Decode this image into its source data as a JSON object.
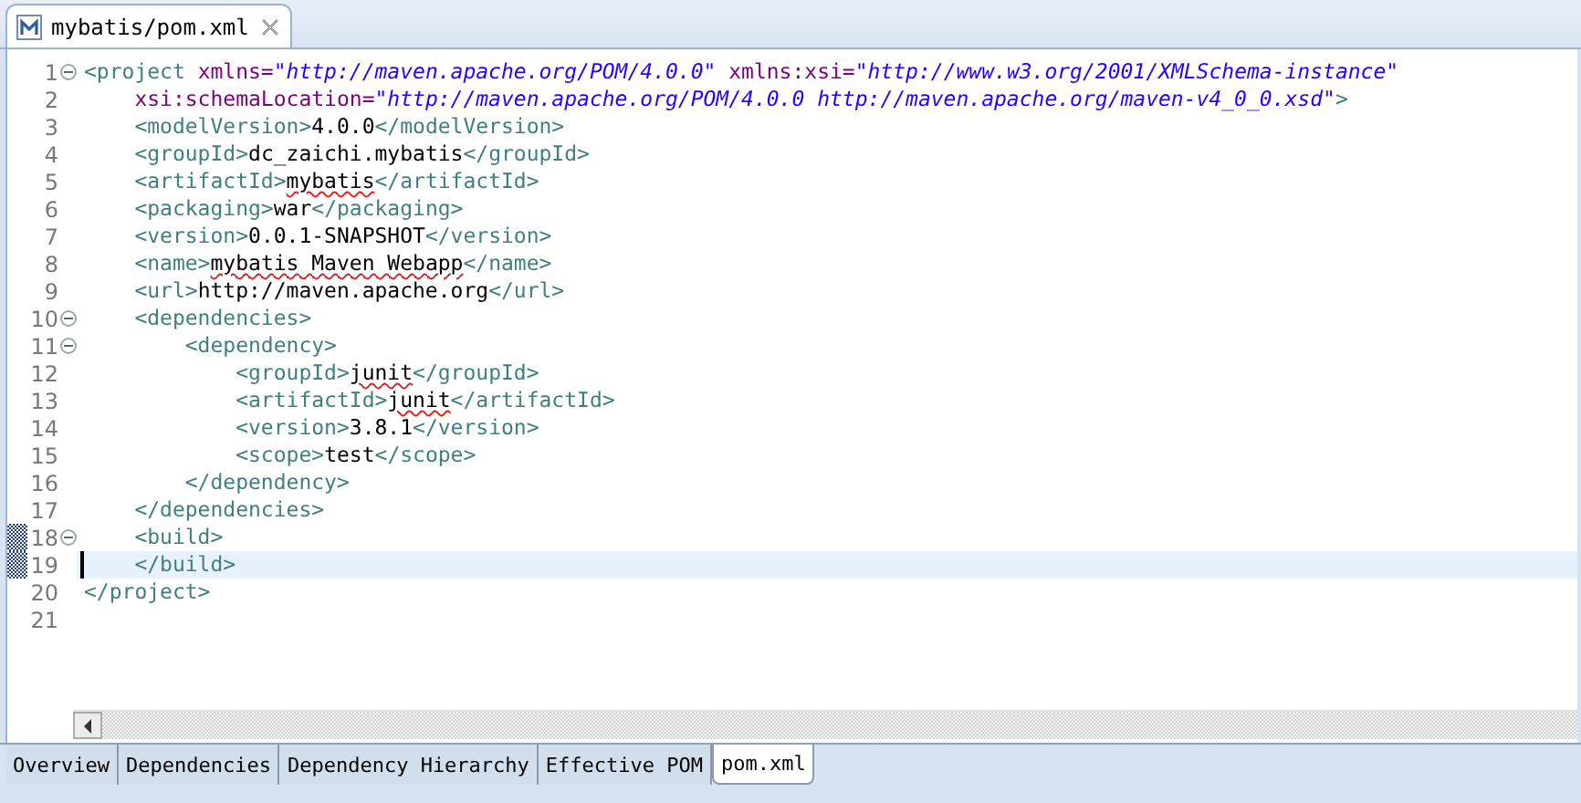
{
  "editor_tab": {
    "title": "mybatis/pom.xml",
    "selected": true
  },
  "lines": [
    {
      "number": "1",
      "fold": true,
      "changed": false,
      "current": false,
      "tokens": [
        {
          "kind": "tag",
          "text": "<project"
        },
        {
          "kind": "attr",
          "text": " xmlns="
        },
        {
          "kind": "value",
          "text": "\"http://maven.apache.org/POM/4.0.0\""
        },
        {
          "kind": "attr",
          "text": " xmlns:xsi="
        },
        {
          "kind": "value",
          "text": "\"http://www.w3.org/2001/XMLSchema-instance\""
        }
      ]
    },
    {
      "number": "2",
      "fold": false,
      "changed": false,
      "current": false,
      "tokens": [
        {
          "kind": "attr",
          "text": "    xsi:schemaLocation="
        },
        {
          "kind": "value",
          "text": "\"http://maven.apache.org/POM/4.0.0 http://maven.apache.org/maven-v4_0_0.xsd\""
        },
        {
          "kind": "tag",
          "text": ">"
        }
      ]
    },
    {
      "number": "3",
      "fold": false,
      "changed": false,
      "current": false,
      "tokens": [
        {
          "kind": "tag",
          "text": "    <modelVersion>"
        },
        {
          "kind": "text",
          "text": "4.0.0"
        },
        {
          "kind": "tag",
          "text": "</modelVersion>"
        }
      ]
    },
    {
      "number": "4",
      "fold": false,
      "changed": false,
      "current": false,
      "tokens": [
        {
          "kind": "tag",
          "text": "    <groupId>"
        },
        {
          "kind": "text",
          "text": "dc_zaichi.mybatis"
        },
        {
          "kind": "tag",
          "text": "</groupId>"
        }
      ]
    },
    {
      "number": "5",
      "fold": false,
      "changed": false,
      "current": false,
      "tokens": [
        {
          "kind": "tag",
          "text": "    <artifactId>"
        },
        {
          "kind": "misspelled",
          "text": "mybatis"
        },
        {
          "kind": "tag",
          "text": "</artifactId>"
        }
      ]
    },
    {
      "number": "6",
      "fold": false,
      "changed": false,
      "current": false,
      "tokens": [
        {
          "kind": "tag",
          "text": "    <packaging>"
        },
        {
          "kind": "text",
          "text": "war"
        },
        {
          "kind": "tag",
          "text": "</packaging>"
        }
      ]
    },
    {
      "number": "7",
      "fold": false,
      "changed": false,
      "current": false,
      "tokens": [
        {
          "kind": "tag",
          "text": "    <version>"
        },
        {
          "kind": "text",
          "text": "0.0.1-SNAPSHOT"
        },
        {
          "kind": "tag",
          "text": "</version>"
        }
      ]
    },
    {
      "number": "8",
      "fold": false,
      "changed": false,
      "current": false,
      "tokens": [
        {
          "kind": "tag",
          "text": "    <name>"
        },
        {
          "kind": "misspelled",
          "text": "mybatis Maven Webapp"
        },
        {
          "kind": "tag",
          "text": "</name>"
        }
      ]
    },
    {
      "number": "9",
      "fold": false,
      "changed": false,
      "current": false,
      "tokens": [
        {
          "kind": "tag",
          "text": "    <url>"
        },
        {
          "kind": "text",
          "text": "http://maven.apache.org"
        },
        {
          "kind": "tag",
          "text": "</url>"
        }
      ]
    },
    {
      "number": "10",
      "fold": true,
      "changed": false,
      "current": false,
      "tokens": [
        {
          "kind": "tag",
          "text": "    <dependencies>"
        }
      ]
    },
    {
      "number": "11",
      "fold": true,
      "changed": false,
      "current": false,
      "tokens": [
        {
          "kind": "tag",
          "text": "        <dependency>"
        }
      ]
    },
    {
      "number": "12",
      "fold": false,
      "changed": false,
      "current": false,
      "tokens": [
        {
          "kind": "tag",
          "text": "            <groupId>"
        },
        {
          "kind": "misspelled",
          "text": "junit"
        },
        {
          "kind": "tag",
          "text": "</groupId>"
        }
      ]
    },
    {
      "number": "13",
      "fold": false,
      "changed": false,
      "current": false,
      "tokens": [
        {
          "kind": "tag",
          "text": "            <artifactId>"
        },
        {
          "kind": "misspelled",
          "text": "junit"
        },
        {
          "kind": "tag",
          "text": "</artifactId>"
        }
      ]
    },
    {
      "number": "14",
      "fold": false,
      "changed": false,
      "current": false,
      "tokens": [
        {
          "kind": "tag",
          "text": "            <version>"
        },
        {
          "kind": "text",
          "text": "3.8.1"
        },
        {
          "kind": "tag",
          "text": "</version>"
        }
      ]
    },
    {
      "number": "15",
      "fold": false,
      "changed": false,
      "current": false,
      "tokens": [
        {
          "kind": "tag",
          "text": "            <scope>"
        },
        {
          "kind": "text",
          "text": "test"
        },
        {
          "kind": "tag",
          "text": "</scope>"
        }
      ]
    },
    {
      "number": "16",
      "fold": false,
      "changed": false,
      "current": false,
      "tokens": [
        {
          "kind": "tag",
          "text": "        </dependency>"
        }
      ]
    },
    {
      "number": "17",
      "fold": false,
      "changed": false,
      "current": false,
      "tokens": [
        {
          "kind": "tag",
          "text": "    </dependencies>"
        }
      ]
    },
    {
      "number": "18",
      "fold": true,
      "changed": true,
      "current": false,
      "tokens": [
        {
          "kind": "tag",
          "text": "    <build>"
        }
      ]
    },
    {
      "number": "19",
      "fold": false,
      "changed": true,
      "current": true,
      "tokens": [
        {
          "kind": "tag",
          "text": "    </build>"
        }
      ]
    },
    {
      "number": "20",
      "fold": false,
      "changed": false,
      "current": false,
      "tokens": [
        {
          "kind": "tag",
          "text": "</project>"
        }
      ]
    },
    {
      "number": "21",
      "fold": false,
      "changed": false,
      "current": false
    }
  ],
  "page_tabs": [
    {
      "label": "Overview",
      "selected": false
    },
    {
      "label": "Dependencies",
      "selected": false
    },
    {
      "label": "Dependency Hierarchy",
      "selected": false
    },
    {
      "label": "Effective POM",
      "selected": false
    },
    {
      "label": "pom.xml",
      "selected": true
    }
  ]
}
